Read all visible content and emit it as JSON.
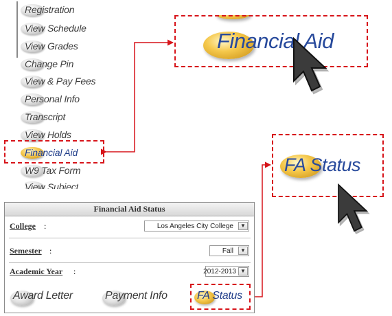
{
  "nav": {
    "items": [
      {
        "label": "Registration",
        "active": false
      },
      {
        "label": "View Schedule",
        "active": false
      },
      {
        "label": "View Grades",
        "active": false
      },
      {
        "label": "Change Pin",
        "active": false
      },
      {
        "label": "View & Pay Fees",
        "active": false
      },
      {
        "label": "Personal Info",
        "active": false
      },
      {
        "label": "Transcript",
        "active": false
      },
      {
        "label": "View Holds",
        "active": false
      },
      {
        "label": "Financial Aid",
        "active": true
      },
      {
        "label": "W9 Tax Form",
        "active": false
      },
      {
        "label": "View Subject",
        "active": false
      }
    ]
  },
  "callouts": {
    "financial_aid_label": "Financial Aid",
    "fa_status_prefix": "FA",
    "fa_status_suffix": "Status"
  },
  "panel": {
    "title": "Financial Aid Status",
    "college": {
      "label": "College",
      "value": "Los Angeles City College"
    },
    "semester": {
      "label": "Semester",
      "value": "Fall"
    },
    "academic_year": {
      "label": "Academic Year",
      "value": "2012-2013"
    },
    "buttons": {
      "award_letter": "Award Letter",
      "payment_info": "Payment Info",
      "fa_status": "FA Status"
    }
  },
  "colors": {
    "highlight": "#d7141a",
    "link_blue": "#213e8a",
    "gold": "#f4c64a"
  },
  "icons": {
    "cursor": "mouse-pointer-icon",
    "dropdown": "chevron-down-icon"
  }
}
